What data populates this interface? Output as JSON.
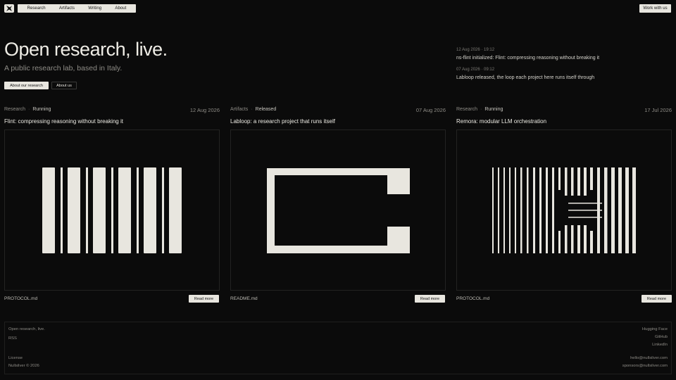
{
  "nav": {
    "items": [
      "Research",
      "Artifacts",
      "Writing",
      "About"
    ],
    "cta": "Work with us"
  },
  "hero": {
    "title": "Open research, live.",
    "subtitle": "A public research lab, based in Italy.",
    "primary_button": "About our research",
    "secondary_button": "About us"
  },
  "news": [
    {
      "date": "12 Aug 2026 · 19:12",
      "text": "ns-flint initialized: Flint: compressing reasoning without breaking it"
    },
    {
      "date": "07 Aug 2026 · 09:12",
      "text": "Labloop released, the loop each project here runs itself through"
    }
  ],
  "cards": [
    {
      "category": "Research",
      "separator": "·",
      "status": "Running",
      "date": "12 Aug 2026",
      "title": "Flint: compressing reasoning without breaking it",
      "file": "PROTOCOL.md",
      "button": "Read more",
      "art_icon": "vertical-bars-pattern"
    },
    {
      "category": "Artifacts",
      "separator": "·",
      "status": "Released",
      "date": "07 Aug 2026",
      "title": "Labloop: a research project that runs itself",
      "file": "README.md",
      "button": "Read more",
      "art_icon": "loop-bracket-shape"
    },
    {
      "category": "Research",
      "separator": "·",
      "status": "Running",
      "date": "17 Jul 2026",
      "title": "Remora: modular LLM orchestration",
      "file": "PROTOCOL.md",
      "button": "Read more",
      "art_icon": "striped-lines-pattern"
    }
  ],
  "footer": {
    "tagline": "Open research, live.",
    "rss": "RSS",
    "license": "License",
    "copyright": "Nullsilver © 2026",
    "links": [
      "Hugging Face",
      "GitHub",
      "LinkedIn"
    ],
    "emails": [
      "hello@nullsilver.com",
      "sponsors@nullsilver.com"
    ]
  },
  "colors": {
    "background": "#0b0b0b",
    "foreground": "#e8e6df",
    "muted": "#8e8c86"
  }
}
